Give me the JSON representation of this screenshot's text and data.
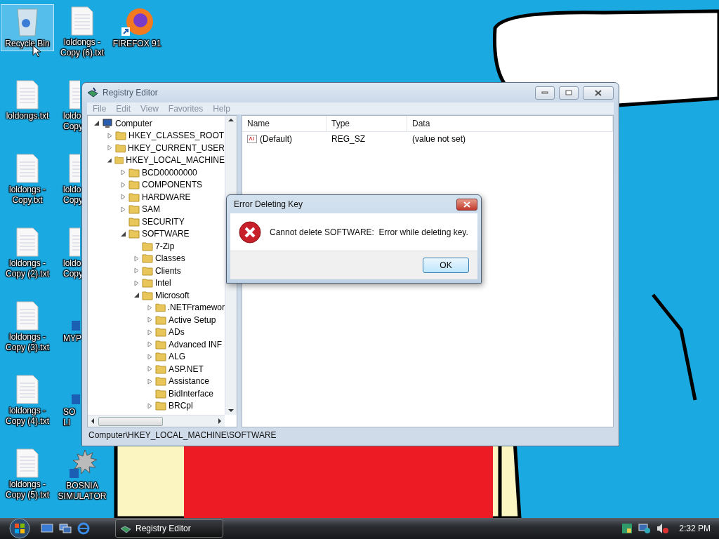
{
  "desktop_icons": [
    {
      "kind": "recycle",
      "label": "Recycle Bin",
      "selected": true,
      "covered": false
    },
    {
      "kind": "text",
      "label": "loldongs.txt",
      "selected": false,
      "covered": false
    },
    {
      "kind": "text",
      "label": "loldongs - Copy.txt",
      "selected": false,
      "covered": false
    },
    {
      "kind": "text",
      "label": "loldongs - Copy (2).txt",
      "selected": false,
      "covered": false
    },
    {
      "kind": "text",
      "label": "loldongs - Copy (3).txt",
      "selected": false,
      "covered": false
    },
    {
      "kind": "text",
      "label": "loldongs - Copy (4).txt",
      "selected": false,
      "covered": false
    },
    {
      "kind": "text",
      "label": "loldongs - Copy (5).txt",
      "selected": false,
      "covered": false
    },
    {
      "kind": "text",
      "label": "loldongs - Copy (6).txt",
      "selected": false,
      "covered": false
    },
    {
      "kind": "text",
      "label": "loldo Copy",
      "selected": false,
      "covered": true
    },
    {
      "kind": "text",
      "label": "loldo Copy",
      "selected": false,
      "covered": true
    },
    {
      "kind": "text",
      "label": "loldo Copy",
      "selected": false,
      "covered": true
    },
    {
      "kind": "game",
      "label": "MYP",
      "selected": false,
      "covered": true
    },
    {
      "kind": "cards",
      "label": "SO LI",
      "selected": false,
      "covered": true
    },
    {
      "kind": "mine",
      "label": "BOSNIA SIMULATOR",
      "selected": false,
      "covered": false
    },
    {
      "kind": "browser",
      "label": "FIREFOX 91",
      "selected": false,
      "covered": false
    }
  ],
  "registry_editor": {
    "title": "Registry Editor",
    "menu": [
      "File",
      "Edit",
      "View",
      "Favorites",
      "Help"
    ],
    "tree": [
      {
        "label": "Computer",
        "kind": "computer",
        "expandable": true,
        "expanded": true,
        "children": [
          {
            "label": "HKEY_CLASSES_ROOT",
            "expandable": true,
            "expanded": false
          },
          {
            "label": "HKEY_CURRENT_USER",
            "expandable": true,
            "expanded": false
          },
          {
            "label": "HKEY_LOCAL_MACHINE",
            "expandable": true,
            "expanded": true,
            "children": [
              {
                "label": "BCD00000000",
                "expandable": true,
                "expanded": false
              },
              {
                "label": "COMPONENTS",
                "expandable": true,
                "expanded": false
              },
              {
                "label": "HARDWARE",
                "expandable": true,
                "expanded": false
              },
              {
                "label": "SAM",
                "expandable": true,
                "expanded": false
              },
              {
                "label": "SECURITY",
                "expandable": false
              },
              {
                "label": "SOFTWARE",
                "expandable": true,
                "expanded": true,
                "children": [
                  {
                    "label": "7-Zip",
                    "expandable": false
                  },
                  {
                    "label": "Classes",
                    "expandable": true,
                    "expanded": false
                  },
                  {
                    "label": "Clients",
                    "expandable": true,
                    "expanded": false
                  },
                  {
                    "label": "Intel",
                    "expandable": true,
                    "expanded": false
                  },
                  {
                    "label": "Microsoft",
                    "expandable": true,
                    "expanded": true,
                    "children": [
                      {
                        "label": ".NETFramewor",
                        "expandable": true,
                        "expanded": false
                      },
                      {
                        "label": "Active Setup",
                        "expandable": true,
                        "expanded": false
                      },
                      {
                        "label": "ADs",
                        "expandable": true,
                        "expanded": false
                      },
                      {
                        "label": "Advanced INF",
                        "expandable": true,
                        "expanded": false
                      },
                      {
                        "label": "ALG",
                        "expandable": true,
                        "expanded": false
                      },
                      {
                        "label": "ASP.NET",
                        "expandable": true,
                        "expanded": false
                      },
                      {
                        "label": "Assistance",
                        "expandable": true,
                        "expanded": false
                      },
                      {
                        "label": "BidInterface",
                        "expandable": false
                      },
                      {
                        "label": "BRCpl",
                        "expandable": true,
                        "expanded": false
                      }
                    ]
                  }
                ]
              }
            ]
          }
        ]
      }
    ],
    "columns": [
      "Name",
      "Type",
      "Data"
    ],
    "values": [
      {
        "name": "(Default)",
        "type": "REG_SZ",
        "data": "(value not set)"
      }
    ],
    "status": "Computer\\HKEY_LOCAL_MACHINE\\SOFTWARE"
  },
  "dialog": {
    "title": "Error Deleting Key",
    "message": "Cannot delete SOFTWARE:  Error while deleting key.",
    "buttons": [
      "OK"
    ]
  },
  "taskbar": {
    "tasks": [
      {
        "label": "Registry Editor",
        "selected": true
      }
    ],
    "clock": "2:32 PM"
  }
}
